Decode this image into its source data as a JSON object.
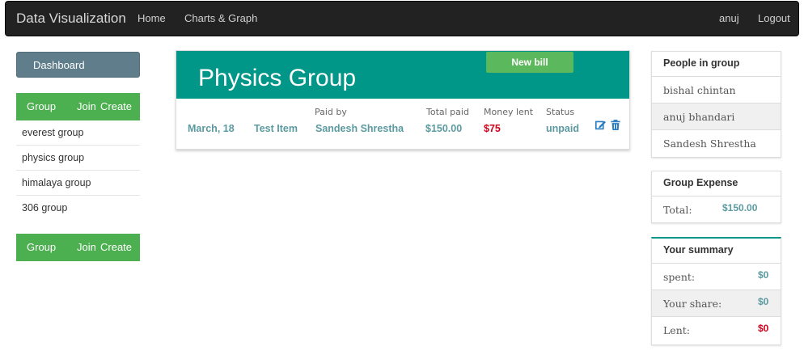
{
  "navbar": {
    "brand": "Data Visualization",
    "home": "Home",
    "charts": "Charts & Graph",
    "user": "anuj",
    "logout": "Logout"
  },
  "sidebar": {
    "dashboard": "Dashboard",
    "bar_top": {
      "group": "Group",
      "join": "Join",
      "create": "Create"
    },
    "groups": [
      "everest group",
      "physics group",
      "himalaya group",
      "306 group"
    ],
    "bar_bottom": {
      "group": "Group",
      "join": "Join",
      "create": "Create"
    }
  },
  "main": {
    "title": "Physics Group",
    "new_bill": "New bill",
    "columns": {
      "paid_by": "Paid by",
      "total_paid": "Total paid",
      "money_lent": "Money lent",
      "status": "Status"
    },
    "row": {
      "date": "March, 18",
      "item": "Test Item",
      "paid_by": "Sandesh Shrestha",
      "total_paid": "$150.00",
      "money_lent": "$75",
      "status": "unpaid"
    },
    "icons": [
      "edit-icon",
      "trash-icon"
    ]
  },
  "people": {
    "title": "People in group",
    "members": [
      "bishal chintan",
      "anuj bhandari",
      "Sandesh Shrestha"
    ]
  },
  "expense": {
    "title": "Group Expense",
    "total_label": "Total:",
    "total_value": "$150.00"
  },
  "summary": {
    "title": "Your summary",
    "spent_label": "spent:",
    "spent_value": "$0",
    "share_label": "Your share:",
    "share_value": "$0",
    "lent_label": "Lent:",
    "lent_value": "$0"
  },
  "colors": {
    "teal": "#009688",
    "green": "#4caf50",
    "slate": "#607d8b",
    "red": "#d0021b"
  }
}
